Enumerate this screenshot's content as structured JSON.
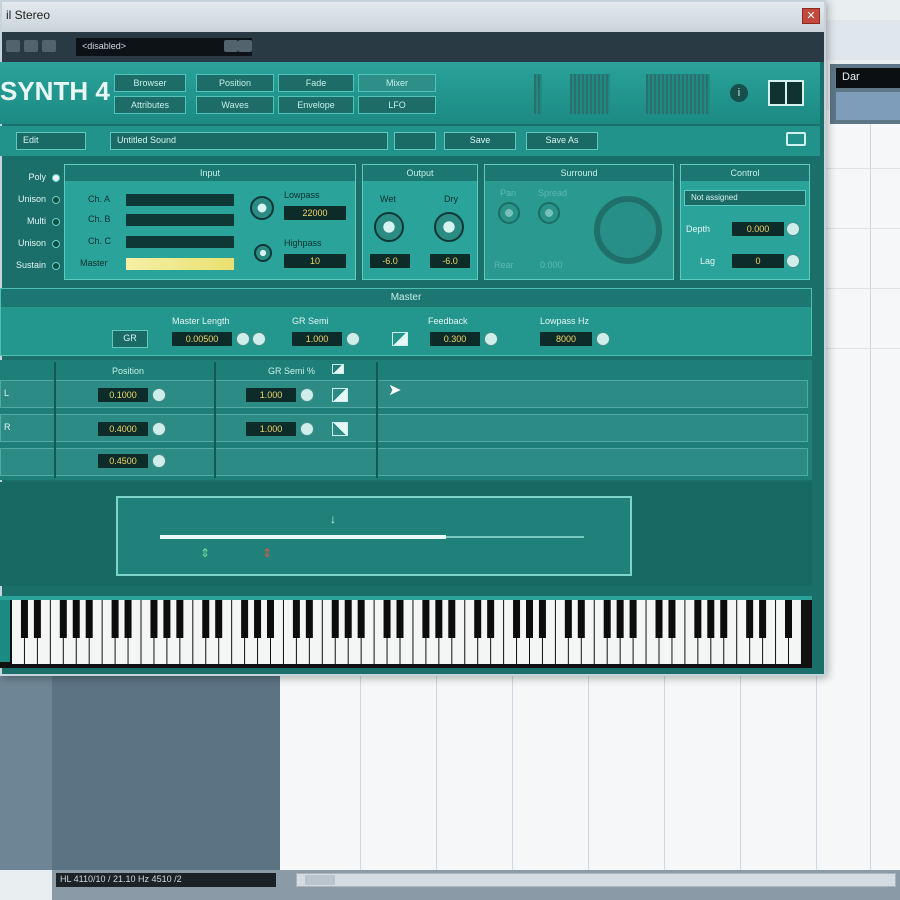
{
  "window": {
    "title": "il Stereo",
    "close_glyph": "✕",
    "preset_field": "<disabled>",
    "plugin_name": "SYNTH 4"
  },
  "header_buttons": {
    "browser": "Browser",
    "attributes": "Attributes",
    "position": "Position",
    "waves": "Waves",
    "fade": "Fade",
    "envelope": "Envelope",
    "mixer": "Mixer",
    "lfo": "LFO"
  },
  "subtoolbar": {
    "mode": "Edit",
    "sound_name": "Untitled Sound",
    "save_label": "Save",
    "save_as_label": "Save As"
  },
  "sidebar": {
    "items": [
      "Poly",
      "Unison",
      "Multi",
      "Unison",
      "Sustain"
    ]
  },
  "input_panel": {
    "title": "Input",
    "channels": [
      "Ch. A",
      "Ch. B",
      "Ch. C",
      "Master"
    ],
    "lowpass_label": "Lowpass",
    "lowpass_value": "22000",
    "highpass_label": "Highpass",
    "highpass_value": "10"
  },
  "output_panel": {
    "title": "Output",
    "wet_label": "Wet",
    "dry_label": "Dry",
    "wet_value": "-6.0",
    "dry_value": "-6.0"
  },
  "surround_panel": {
    "title": "Surround",
    "pan_label": "Pan",
    "spread_label": "Spread",
    "rear_label": "Rear",
    "rear_value": "0.000"
  },
  "control_panel": {
    "title": "Control",
    "dropdown_value": "Not assigned",
    "depth_label": "Depth",
    "depth_value": "0.000",
    "lag_label": "Lag",
    "lag_value": "0"
  },
  "master": {
    "title": "Master",
    "gr_button": "GR",
    "master_length_label": "Master Length",
    "master_length_value": "0.00500",
    "gr_semi_label": "GR Semi",
    "gr_semi_value": "1.000",
    "feedback_label": "Feedback",
    "feedback_value": "0.300",
    "lowpass_hz_label": "Lowpass Hz",
    "lowpass_hz_value": "8000"
  },
  "table": {
    "headers": [
      "Position",
      "GR Semi %"
    ],
    "rows": [
      {
        "label": "L",
        "position": "0.1000",
        "semi": "1.000"
      },
      {
        "label": "R",
        "position": "0.4000",
        "semi": "1.000"
      },
      {
        "label": "",
        "position": "0.4500",
        "semi": ""
      }
    ]
  },
  "daw": {
    "strip_label": "Dar",
    "status_text": "HL  4110/10 / 21.10  Hz  4510 /2"
  },
  "colors": {
    "panel": "#2aa39a",
    "accent_yellow": "#f1d96a",
    "window_dark": "#176963"
  },
  "icons": [
    "close-icon",
    "info-icon",
    "book-icon",
    "sound-icon",
    "knob-icon",
    "curve-icon",
    "cursor-icon"
  ]
}
